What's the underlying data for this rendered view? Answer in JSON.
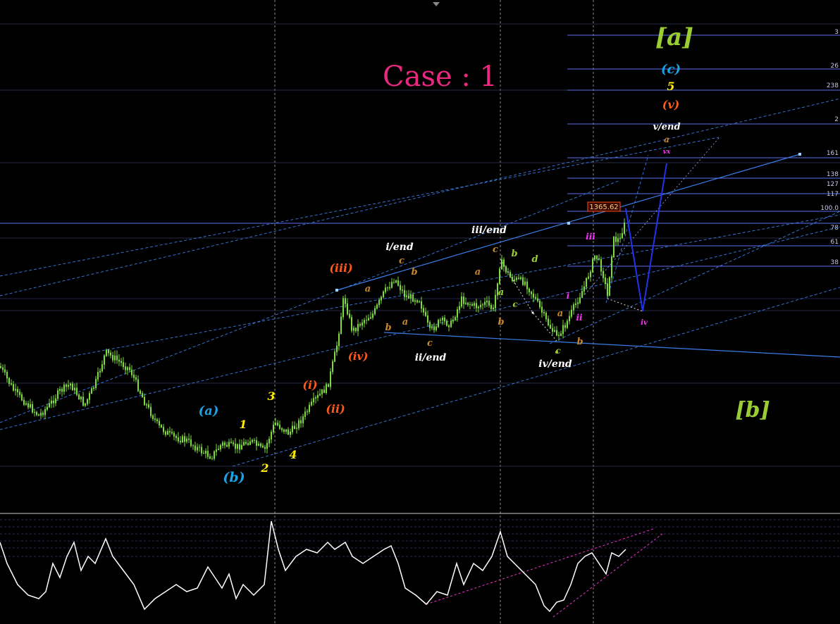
{
  "chart_data": {
    "type": "candlestick",
    "title": "Case : 1",
    "price_label": "1365.62",
    "fib_right_labels": [
      "3",
      "26",
      "238",
      "2",
      "161",
      "138",
      "127",
      "117",
      "100.0",
      "78",
      "61",
      "38"
    ],
    "wave_labels": [
      {
        "text": "[a]",
        "color": "#9acd32"
      },
      {
        "text": "[b]",
        "color": "#9acd32"
      },
      {
        "text": "(c)",
        "color": "#1aa3e8"
      },
      {
        "text": "5",
        "color": "#ffee00"
      },
      {
        "text": "(v)",
        "color": "#ff5a1a"
      },
      {
        "text": "v/end",
        "color": "#ffffff"
      },
      {
        "text": "a",
        "color": "#c8882a"
      },
      {
        "text": "vx",
        "color": "#ff33ff"
      },
      {
        "text": "iii",
        "color": "#ff33ff"
      },
      {
        "text": "i",
        "color": "#ff33ff"
      },
      {
        "text": "ii",
        "color": "#ff33ff"
      },
      {
        "text": "iv",
        "color": "#ff33ff"
      },
      {
        "text": "a",
        "color": "#c8882a"
      },
      {
        "text": "b",
        "color": "#c8882a"
      },
      {
        "text": "c",
        "color": "#9acd32"
      },
      {
        "text": "iv/end",
        "color": "#ffffff"
      },
      {
        "text": "iii/end",
        "color": "#ffffff"
      },
      {
        "text": "c",
        "color": "#c8882a"
      },
      {
        "text": "b",
        "color": "#9acd32"
      },
      {
        "text": "d",
        "color": "#9acd32"
      },
      {
        "text": "a",
        "color": "#c8882a"
      },
      {
        "text": "a",
        "color": "#9acd32"
      },
      {
        "text": "c",
        "color": "#9acd32"
      },
      {
        "text": "b",
        "color": "#c8882a"
      },
      {
        "text": "i/end",
        "color": "#ffffff"
      },
      {
        "text": "c",
        "color": "#c8882a"
      },
      {
        "text": "b",
        "color": "#c8882a"
      },
      {
        "text": "a",
        "color": "#c8882a"
      },
      {
        "text": "a",
        "color": "#c8882a"
      },
      {
        "text": "b",
        "color": "#c8882a"
      },
      {
        "text": "c",
        "color": "#c8882a"
      },
      {
        "text": "ii/end",
        "color": "#ffffff"
      },
      {
        "text": "(iii)",
        "color": "#ff5a1a"
      },
      {
        "text": "(iv)",
        "color": "#ff5a1a"
      },
      {
        "text": "(i)",
        "color": "#ff5a1a"
      },
      {
        "text": "(ii)",
        "color": "#ff5a1a"
      },
      {
        "text": "(a)",
        "color": "#1aa3e8"
      },
      {
        "text": "(b)",
        "color": "#1aa3e8"
      },
      {
        "text": "1",
        "color": "#ffee00"
      },
      {
        "text": "2",
        "color": "#ffee00"
      },
      {
        "text": "3",
        "color": "#ffee00"
      },
      {
        "text": "4",
        "color": "#ffee00"
      }
    ],
    "colors": {
      "background": "#000000",
      "candles": "#7ddc3a",
      "fib_lines": "#5c6ff0",
      "trendlines": "#3a7de8",
      "projection": "#2233ee",
      "oscillator": "#ffffff",
      "osc_trend": "#ee33cc"
    }
  }
}
